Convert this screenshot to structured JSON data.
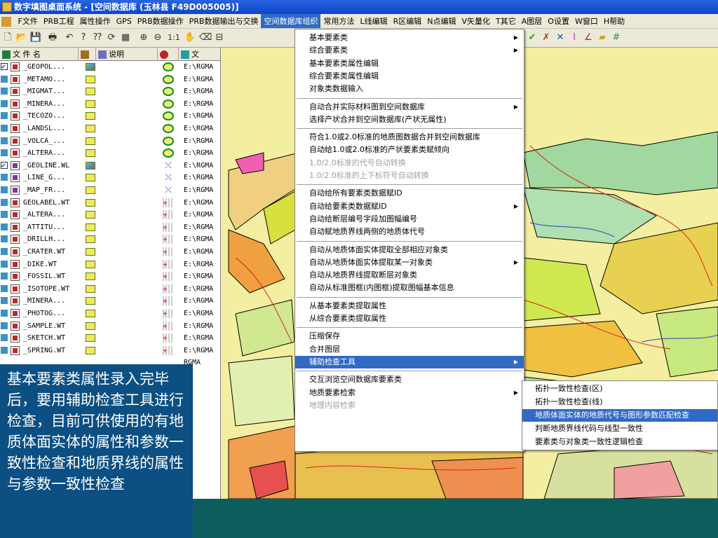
{
  "window": {
    "title": "数字填图桌面系统 - [空间数据库    (玉林县    F49D005005)]"
  },
  "menu": [
    {
      "label": "F文件",
      "active": false
    },
    {
      "label": "PRB工程",
      "active": false
    },
    {
      "label": "属性操作",
      "active": false
    },
    {
      "label": "GPS",
      "active": false
    },
    {
      "label": "PRB数据操作",
      "active": false
    },
    {
      "label": "PRB数据输出与交换",
      "active": false
    },
    {
      "label": "空间数据库组织",
      "active": true
    },
    {
      "label": "常用方法",
      "active": false
    },
    {
      "label": "L线编辑",
      "active": false
    },
    {
      "label": "R区编辑",
      "active": false
    },
    {
      "label": "N点编辑",
      "active": false
    },
    {
      "label": "V矢量化",
      "active": false
    },
    {
      "label": "T其它",
      "active": false
    },
    {
      "label": "A图层",
      "active": false
    },
    {
      "label": "O设置",
      "active": false
    },
    {
      "label": "W窗口",
      "active": false
    },
    {
      "label": "H帮助",
      "active": false
    }
  ],
  "toolbar": {
    "zoom_label": "1:1"
  },
  "panel": {
    "col_filename": "文 件 名",
    "col_desc": "说明",
    "col_file": "文"
  },
  "layers": [
    {
      "name": "_GEOPOL...",
      "path": "E:\\RGMA",
      "checked": true,
      "kind": "poly"
    },
    {
      "name": "_METAMO...",
      "path": "E:\\RGMA",
      "checked": false,
      "kind": "poly"
    },
    {
      "name": "_MIGMAT...",
      "path": "E:\\RGMA",
      "checked": false,
      "kind": "poly"
    },
    {
      "name": "_MINERA...",
      "path": "E:\\RGMA",
      "checked": false,
      "kind": "poly"
    },
    {
      "name": "_TECOZO...",
      "path": "E:\\RGMA",
      "checked": false,
      "kind": "poly"
    },
    {
      "name": "_LANDSL...",
      "path": "E:\\RGMA",
      "checked": false,
      "kind": "poly"
    },
    {
      "name": "_VOLCA_...",
      "path": "E:\\RGMA",
      "checked": false,
      "kind": "poly"
    },
    {
      "name": "_ALTERA...",
      "path": "E:\\RGMA",
      "checked": false,
      "kind": "poly"
    },
    {
      "name": "_GEOLINE.WL",
      "path": "E:\\RGMA",
      "checked": true,
      "kind": "line"
    },
    {
      "name": "_LINE_G...",
      "path": "E:\\RGMA",
      "checked": false,
      "kind": "line"
    },
    {
      "name": "_MAP_FR...",
      "path": "E:\\RGMA",
      "checked": false,
      "kind": "line"
    },
    {
      "name": "GEOLABEL.WT",
      "path": "E:\\RGMA",
      "checked": false,
      "kind": "point"
    },
    {
      "name": "_ALTERA...",
      "path": "E:\\RGMA",
      "checked": false,
      "kind": "point"
    },
    {
      "name": "_ATTITU...",
      "path": "E:\\RGMA",
      "checked": false,
      "kind": "point"
    },
    {
      "name": "_DRILLH...",
      "path": "E:\\RGMA",
      "checked": false,
      "kind": "point"
    },
    {
      "name": "_CRATER.WT",
      "path": "E:\\RGMA",
      "checked": false,
      "kind": "point"
    },
    {
      "name": "_DIKE.WT",
      "path": "E:\\RGMA",
      "checked": false,
      "kind": "point"
    },
    {
      "name": "_FOSSIL.WT",
      "path": "E:\\RGMA",
      "checked": false,
      "kind": "point"
    },
    {
      "name": "_ISOTOPE.WT",
      "path": "E:\\RGMA",
      "checked": false,
      "kind": "point"
    },
    {
      "name": "_MINERA...",
      "path": "E:\\RGMA",
      "checked": false,
      "kind": "point"
    },
    {
      "name": "_PHOTOG...",
      "path": "E:\\RGMA",
      "checked": false,
      "kind": "point"
    },
    {
      "name": "_SAMPLE.WT",
      "path": "E:\\RGMA",
      "checked": false,
      "kind": "point"
    },
    {
      "name": "_SKETCH.WT",
      "path": "E:\\RGMA",
      "checked": false,
      "kind": "point"
    },
    {
      "name": "_SPRING.WT",
      "path": "E:\\RGMA",
      "checked": false,
      "kind": "point"
    }
  ],
  "hidden_row_path": "RGMA",
  "dropdown": [
    {
      "label": "基本要素类",
      "submenu": true,
      "disabled": false
    },
    {
      "label": "综合要素类",
      "submenu": true,
      "disabled": false
    },
    {
      "label": "基本要素类属性编辑",
      "submenu": false,
      "disabled": false
    },
    {
      "label": "综合要素类属性编辑",
      "submenu": false,
      "disabled": false
    },
    {
      "label": "对象类数据输入",
      "submenu": false,
      "disabled": false
    },
    {
      "sep": true
    },
    {
      "label": "自动合并实际材料图到空间数据库",
      "submenu": true,
      "disabled": false
    },
    {
      "label": "选择产状合并到空间数据库(产状无属性)",
      "submenu": false,
      "disabled": false
    },
    {
      "sep": true
    },
    {
      "label": "符合1.0或2.0标准的地质图数据合并到空间数据库",
      "submenu": false,
      "disabled": false
    },
    {
      "label": "自动给1.0或2.0标准的产状要素类赋倾向",
      "submenu": false,
      "disabled": false
    },
    {
      "label": "1.0/2.0标准的代号自动转换",
      "submenu": false,
      "disabled": true
    },
    {
      "label": "1.0/2.0标准的上下标符号自动转换",
      "submenu": false,
      "disabled": true
    },
    {
      "sep": true
    },
    {
      "label": "自动给所有要素类数据赋ID",
      "submenu": false,
      "disabled": false
    },
    {
      "label": "自动给要素类数据赋ID",
      "submenu": true,
      "disabled": false
    },
    {
      "label": "自动给断层编号字段加图幅编号",
      "submenu": false,
      "disabled": false
    },
    {
      "label": "自动赋地质界线两侧的地质体代号",
      "submenu": false,
      "disabled": false
    },
    {
      "sep": true
    },
    {
      "label": "自动从地质体面实体提取全部相应对象类",
      "submenu": false,
      "disabled": false
    },
    {
      "label": "自动从地质体面实体提取某一对象类",
      "submenu": true,
      "disabled": false
    },
    {
      "label": "自动从地质界线提取断层对象类",
      "submenu": false,
      "disabled": false
    },
    {
      "label": "自动从标准图框(内图框)提取图幅基本信息",
      "submenu": false,
      "disabled": false
    },
    {
      "sep": true
    },
    {
      "label": "从基本要素类提取属性",
      "submenu": false,
      "disabled": false
    },
    {
      "label": "从综合要素类提取属性",
      "submenu": false,
      "disabled": false
    },
    {
      "sep": true
    },
    {
      "label": "压缩保存",
      "submenu": false,
      "disabled": false
    },
    {
      "label": "合并图层",
      "submenu": false,
      "disabled": false
    },
    {
      "label": "辅助检查工具",
      "submenu": true,
      "disabled": false,
      "highlight": true
    },
    {
      "sep": true
    },
    {
      "label": "交互浏览空间数据库要素类",
      "submenu": false,
      "disabled": false
    },
    {
      "label": "地质要素检索",
      "submenu": true,
      "disabled": false
    },
    {
      "label": "地理内容检索",
      "submenu": false,
      "disabled": true
    }
  ],
  "submenu": [
    {
      "label": "拓扑一致性检查(区)",
      "highlight": false
    },
    {
      "label": "拓扑一致性检查(线)",
      "highlight": false
    },
    {
      "label": "地质体面实体的地质代号与图形参数匹配检查",
      "highlight": true
    },
    {
      "label": "判断地质界线代码与线型一致性",
      "highlight": false
    },
    {
      "label": "要素类与对象类一致性逻辑检查",
      "highlight": false
    }
  ],
  "overlay_text": "基本要素类属性录入完毕后，要用辅助检查工具进行检查，目前可供使用的有地质体面实体的属性和参数一致性检查和地质界线的属性与参数一致性检查",
  "colors": {
    "accent": "#316ac5",
    "title": "#0a46c8",
    "overlay": "#0b4f83",
    "band": "#0b5e5c"
  }
}
